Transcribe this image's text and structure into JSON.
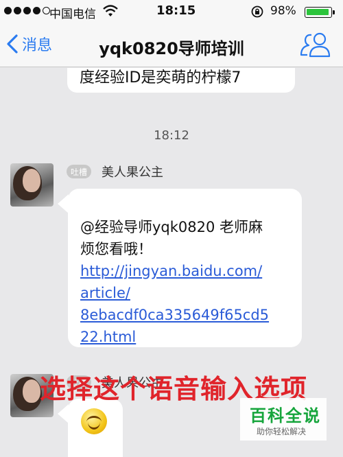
{
  "status_bar": {
    "carrier": "中国电信",
    "time": "18:15",
    "battery_percent": "98%",
    "battery_level": 0.98
  },
  "nav": {
    "back_label": "消息",
    "title": "yqk0820导师培训"
  },
  "chat": {
    "previous_message_partial": "度经验ID是奕萌的柠檬7",
    "timestamp": "18:12",
    "messages": [
      {
        "badge": "吐槽",
        "sender": "美人果公主",
        "text": "@经验导师yqk0820 老师麻烦您看哦！",
        "text_line1": "@经验导师yqk0820 老师麻",
        "text_line2": "烦您看哦！",
        "link": "http://jingyan.baidu.com/article/8ebacdf0ca335649f65cd522.html",
        "link_lines": [
          "http://jingyan.baidu.com/",
          "article/",
          "8ebacdf0ca335649f65cd5",
          "22.html"
        ]
      },
      {
        "badge": "吐槽",
        "sender": "美人果公主",
        "emoji": "smiley-icon"
      }
    ]
  },
  "overlay_caption": "选择这个语音输入选项",
  "watermark": {
    "title": "百科全说",
    "subtitle": "助你轻松解决"
  },
  "colors": {
    "accent_blue": "#2a7bf0",
    "link_blue": "#2a5bd7",
    "battery_green": "#2bc43b",
    "caption_red": "#e0242b",
    "watermark_green": "#16a53c"
  }
}
